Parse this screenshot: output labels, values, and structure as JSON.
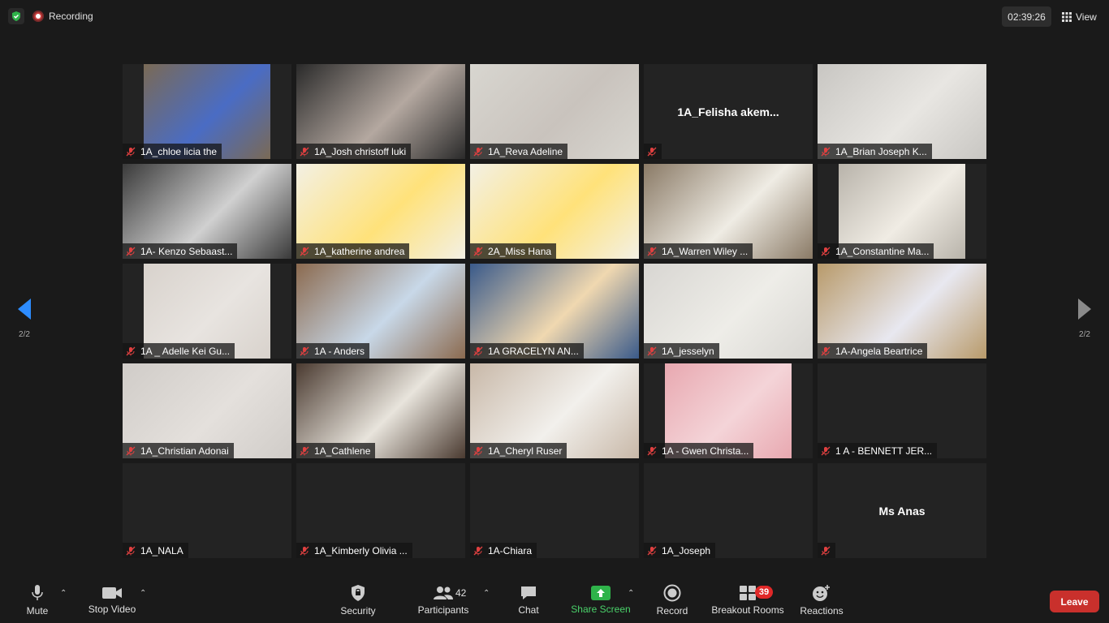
{
  "topbar": {
    "recording_label": "Recording",
    "timer": "02:39:26",
    "view_label": "View"
  },
  "pagination": {
    "left": "2/2",
    "right": "2/2"
  },
  "tiles": [
    {
      "name": "1A_chloe  licia  the",
      "bg": "#7a6a55",
      "photo": "#4a6cc4",
      "img_l": 26,
      "img_w": 156
    },
    {
      "name": "1A_Josh christoff luki",
      "bg": "#2a2a2a",
      "photo": "#b4a8a0",
      "img_l": 0,
      "img_w": 208
    },
    {
      "name": "1A_Reva Adeline",
      "bg": "#d8d6d0",
      "photo": "#c9c3bd",
      "img_l": 0,
      "img_w": 208
    },
    {
      "name": "1A_Felisha  akem...",
      "center": true
    },
    {
      "name": "1A_Brian Joseph K...",
      "bg": "#c8c6c2",
      "photo": "#e8e6e2",
      "img_l": 0,
      "img_w": 208
    },
    {
      "name": "1A- Kenzo Sebaast...",
      "bg": "#3a3a3a",
      "photo": "#d0d0d0",
      "img_l": 0,
      "img_w": 208
    },
    {
      "name": "1A_katherine andrea",
      "bg": "#f3f0e4",
      "photo": "#ffe27a",
      "img_l": 0,
      "img_w": 208
    },
    {
      "name": "2A_Miss Hana",
      "bg": "#f3f0e4",
      "photo": "#ffe27a",
      "img_l": 0,
      "img_w": 208
    },
    {
      "name": "1A_Warren Wiley ...",
      "bg": "#8a7a66",
      "photo": "#efece4",
      "img_l": 0,
      "img_w": 208
    },
    {
      "name": "1A_Constantine Ma...",
      "bg": "#b8b3aa",
      "photo": "#f0ece4",
      "img_l": 26,
      "img_w": 156
    },
    {
      "name": "1A _ Adelle Kei Gu...",
      "bg": "#d8d2cc",
      "photo": "#e8e4e0",
      "img_l": 26,
      "img_w": 156
    },
    {
      "name": "1A - Anders",
      "bg": "#8b6a4f",
      "photo": "#c8d8e8",
      "img_l": 0,
      "img_w": 208
    },
    {
      "name": "1A GRACELYN AN...",
      "bg": "#3a5a8a",
      "photo": "#f0d8b0",
      "img_l": 0,
      "img_w": 208
    },
    {
      "name": "1A_jesselyn",
      "bg": "#d8d6d2",
      "photo": "#eeede8",
      "img_l": 0,
      "img_w": 208
    },
    {
      "name": "1A-Angela Beartrice",
      "bg": "#b89a6a",
      "photo": "#e8e8f0",
      "img_l": 0,
      "img_w": 208
    },
    {
      "name": "1A_Christian Adonai",
      "bg": "#d0ccc8",
      "photo": "#e4e0dc",
      "img_l": 0,
      "img_w": 208
    },
    {
      "name": "1A_Cathlene",
      "bg": "#4a3a30",
      "photo": "#e8e4dc",
      "img_l": 0,
      "img_w": 208
    },
    {
      "name": "1A_Cheryl Ruser",
      "bg": "#c8b8a8",
      "photo": "#f2f0ec",
      "img_l": 0,
      "img_w": 208
    },
    {
      "name": "1A - Gwen Christa...",
      "bg": "#e8a8b0",
      "photo": "#f4d4d8",
      "img_l": 26,
      "img_w": 156
    },
    {
      "name": "1 A - BENNETT JER..."
    },
    {
      "name": "1A_NALA"
    },
    {
      "name": "1A_Kimberly Olivia ..."
    },
    {
      "name": "1A-Chiara"
    },
    {
      "name": "1A_Joseph"
    },
    {
      "name": "",
      "center_label": "Ms Anas"
    }
  ],
  "toolbar": {
    "mute": "Mute",
    "stop_video": "Stop Video",
    "security": "Security",
    "participants": "Participants",
    "participants_count": "42",
    "chat": "Chat",
    "share_screen": "Share Screen",
    "record": "Record",
    "breakout_rooms": "Breakout Rooms",
    "breakout_badge": "39",
    "reactions": "Reactions",
    "leave": "Leave"
  },
  "colors": {
    "background": "#1a1a1a",
    "leave_red": "#c9302c",
    "share_green": "#4ad26a",
    "mute_red": "#e04040"
  }
}
